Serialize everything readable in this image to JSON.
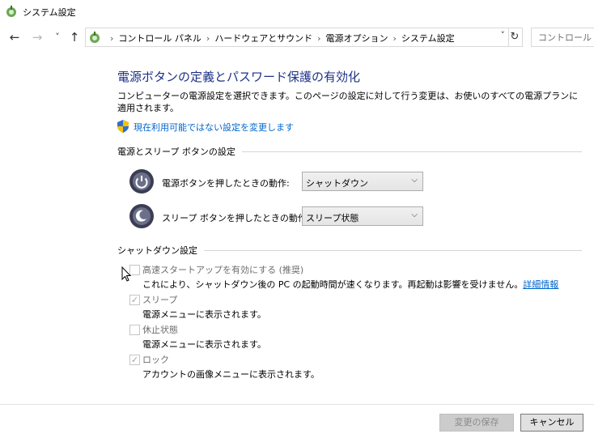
{
  "window": {
    "title": "システム設定"
  },
  "nav": {
    "back": "←",
    "forward": "→",
    "recent": "˅",
    "up": "↑",
    "breadcrumbs": [
      "コントロール パネル",
      "ハードウェアとサウンド",
      "電源オプション",
      "システム設定"
    ],
    "dropdown": "˅",
    "refresh": "↻",
    "search_placeholder": "コントロール パネ"
  },
  "main": {
    "title": "電源ボタンの定義とパスワード保護の有効化",
    "description": "コンピューターの電源設定を選択できます。このページの設定に対して行う変更は、お使いのすべての電源プランに適用されます。",
    "change_link": "現在利用可能ではない設定を変更します",
    "power_section": {
      "heading": "電源とスリープ ボタンの設定",
      "power_button_label": "電源ボタンを押したときの動作:",
      "power_button_value": "シャットダウン",
      "sleep_button_label": "スリープ ボタンを押したときの動作:",
      "sleep_button_value": "スリープ状態"
    },
    "shutdown_section": {
      "heading": "シャットダウン設定",
      "items": [
        {
          "label": "高速スタートアップを有効にする (推奨)",
          "desc": "これにより、シャットダウン後の PC の起動時間が速くなります。再起動は影響を受けません。",
          "link": "詳細情報",
          "checked": false
        },
        {
          "label": "スリープ",
          "desc": "電源メニューに表示されます。",
          "checked": true
        },
        {
          "label": "休止状態",
          "desc": "電源メニューに表示されます。",
          "checked": false
        },
        {
          "label": "ロック",
          "desc": "アカウントの画像メニューに表示されます。",
          "checked": true
        }
      ]
    }
  },
  "footer": {
    "save_label": "変更の保存",
    "cancel_label": "キャンセル"
  },
  "colors": {
    "title_blue": "#1e3287",
    "link_blue": "#0066cc"
  }
}
